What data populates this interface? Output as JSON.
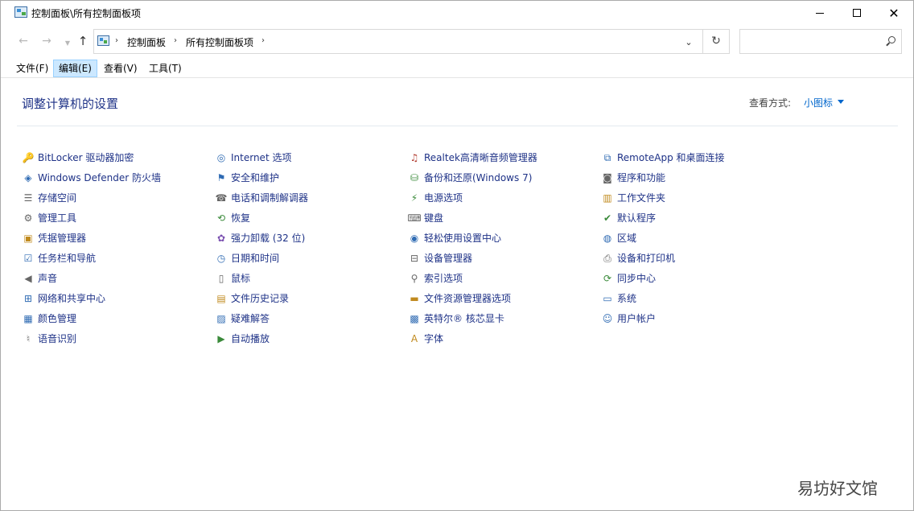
{
  "window": {
    "title": "控制面板\\所有控制面板项"
  },
  "address_bar": {
    "crumbs": [
      "控制面板",
      "所有控制面板项"
    ]
  },
  "search": {
    "value": "",
    "placeholder": ""
  },
  "menu": {
    "file": "文件(F)",
    "edit": "编辑(E)",
    "view": "查看(V)",
    "tools": "工具(T)"
  },
  "content": {
    "title": "调整计算机的设置",
    "view_by_label": "查看方式:",
    "view_by_value": "小图标"
  },
  "items": {
    "col1": [
      {
        "label": "BitLocker 驱动器加密",
        "icon": "bitlocker-icon"
      },
      {
        "label": "Windows Defender 防火墙",
        "icon": "firewall-icon"
      },
      {
        "label": "存储空间",
        "icon": "storage-icon"
      },
      {
        "label": "管理工具",
        "icon": "admin-tools-icon"
      },
      {
        "label": "凭据管理器",
        "icon": "credential-icon"
      },
      {
        "label": "任务栏和导航",
        "icon": "taskbar-icon"
      },
      {
        "label": "声音",
        "icon": "sound-icon"
      },
      {
        "label": "网络和共享中心",
        "icon": "network-icon"
      },
      {
        "label": "颜色管理",
        "icon": "color-icon"
      },
      {
        "label": "语音识别",
        "icon": "microphone-icon"
      }
    ],
    "col2": [
      {
        "label": "Internet 选项",
        "icon": "internet-icon"
      },
      {
        "label": "安全和维护",
        "icon": "flag-icon"
      },
      {
        "label": "电话和调制解调器",
        "icon": "phone-icon"
      },
      {
        "label": "恢复",
        "icon": "recovery-icon"
      },
      {
        "label": "强力卸载 (32 位)",
        "icon": "uninstall-icon"
      },
      {
        "label": "日期和时间",
        "icon": "clock-icon"
      },
      {
        "label": "鼠标",
        "icon": "mouse-icon"
      },
      {
        "label": "文件历史记录",
        "icon": "file-history-icon"
      },
      {
        "label": "疑难解答",
        "icon": "troubleshoot-icon"
      },
      {
        "label": "自动播放",
        "icon": "autoplay-icon"
      }
    ],
    "col3": [
      {
        "label": "Realtek高清晰音频管理器",
        "icon": "audio-manager-icon"
      },
      {
        "label": "备份和还原(Windows 7)",
        "icon": "backup-icon"
      },
      {
        "label": "电源选项",
        "icon": "power-icon"
      },
      {
        "label": "键盘",
        "icon": "keyboard-icon"
      },
      {
        "label": "轻松使用设置中心",
        "icon": "accessibility-icon"
      },
      {
        "label": "设备管理器",
        "icon": "device-manager-icon"
      },
      {
        "label": "索引选项",
        "icon": "index-icon"
      },
      {
        "label": "文件资源管理器选项",
        "icon": "folder-options-icon"
      },
      {
        "label": "英特尔® 核芯显卡",
        "icon": "intel-graphics-icon"
      },
      {
        "label": "字体",
        "icon": "font-icon"
      }
    ],
    "col4": [
      {
        "label": "RemoteApp 和桌面连接",
        "icon": "remoteapp-icon"
      },
      {
        "label": "程序和功能",
        "icon": "programs-icon"
      },
      {
        "label": "工作文件夹",
        "icon": "work-folders-icon"
      },
      {
        "label": "默认程序",
        "icon": "default-programs-icon"
      },
      {
        "label": "区域",
        "icon": "region-icon"
      },
      {
        "label": "设备和打印机",
        "icon": "printer-icon"
      },
      {
        "label": "同步中心",
        "icon": "sync-icon"
      },
      {
        "label": "系统",
        "icon": "system-icon"
      },
      {
        "label": "用户帐户",
        "icon": "users-icon"
      }
    ]
  },
  "watermark": "易坊好文馆",
  "colors": {
    "link": "#1e3287",
    "accent": "#0066cc",
    "menu_active_bg": "#cce8ff"
  }
}
